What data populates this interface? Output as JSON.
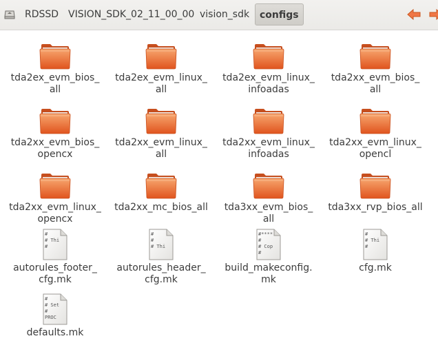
{
  "pathbar": {
    "crumbs": [
      "RDSSD",
      "VISION_SDK_02_11_00_00",
      "vision_sdk",
      "configs"
    ],
    "active": "configs"
  },
  "files": [
    {
      "label": "tda2ex_evm_bios_\nall",
      "type": "folder"
    },
    {
      "label": "tda2ex_evm_linux_\nall",
      "type": "folder"
    },
    {
      "label": "tda2ex_evm_linux_\ninfoadas",
      "type": "folder"
    },
    {
      "label": "tda2xx_evm_bios_\nall",
      "type": "folder"
    },
    {
      "label": "tda2xx_evm_bios_\nopencx",
      "type": "folder"
    },
    {
      "label": "tda2xx_evm_linux_\nall",
      "type": "folder"
    },
    {
      "label": "tda2xx_evm_linux_\ninfoadas",
      "type": "folder"
    },
    {
      "label": "tda2xx_evm_linux_\nopencl",
      "type": "folder"
    },
    {
      "label": "tda2xx_evm_linux_\nopencx",
      "type": "folder"
    },
    {
      "label": "tda2xx_mc_bios_all",
      "type": "folder"
    },
    {
      "label": "tda3xx_evm_bios_\nall",
      "type": "folder"
    },
    {
      "label": "tda3xx_rvp_bios_all",
      "type": "folder"
    },
    {
      "label": "autorules_footer_\ncfg.mk",
      "type": "text",
      "preview": "#\n# Thi\n#"
    },
    {
      "label": "autorules_header_\ncfg.mk",
      "type": "text",
      "preview": "#\n#\n# Thi"
    },
    {
      "label": "build_makeconfig.\nmk",
      "type": "text",
      "preview": "#****\n#\n# Cop\n#"
    },
    {
      "label": "cfg.mk",
      "type": "text",
      "preview": "#\n# Thi\n#"
    },
    {
      "label": "defaults.mk",
      "type": "text",
      "preview": "#\n# Set\n#\nPROC"
    }
  ],
  "colors": {
    "folder_light": "#f7a66e",
    "folder_dark": "#e0541e",
    "accent_orange": "#f07746"
  },
  "icons": {
    "drive": "drive-icon",
    "back": "arrow-left-icon",
    "forward": "arrow-right-icon",
    "folder": "folder-icon",
    "text": "text-file-icon"
  }
}
